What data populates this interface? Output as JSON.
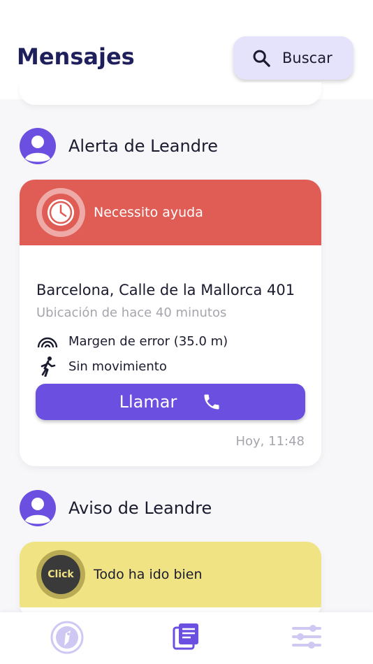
{
  "header": {
    "title": "Mensajes",
    "search_label": "Buscar"
  },
  "alert_section": {
    "title": "Alerta de Leandre",
    "banner_text": "Necessito ayuda",
    "banner_icon": "clock-icon",
    "address": "Barcelona, Calle de la Mallorca 401",
    "location_age": "Ubicación de hace 40 minutos",
    "error_margin": "Margen de error (35.0 m)",
    "movement": "Sin movimiento",
    "call_label": "Llamar",
    "timestamp": "Hoy, 11:48"
  },
  "notice_section": {
    "title": "Aviso de Leandre",
    "badge_text": "Click",
    "banner_text": "Todo ha ido bien"
  },
  "nav": {
    "items": [
      "click-logo-icon",
      "messages-icon",
      "settings-sliders-icon"
    ],
    "active": "messages-icon"
  },
  "colors": {
    "accent": "#6b4fe0",
    "title": "#1f1f5c",
    "alert": "#df5d55",
    "notice": "#f0e383",
    "search_bg": "#e5e2fb"
  }
}
